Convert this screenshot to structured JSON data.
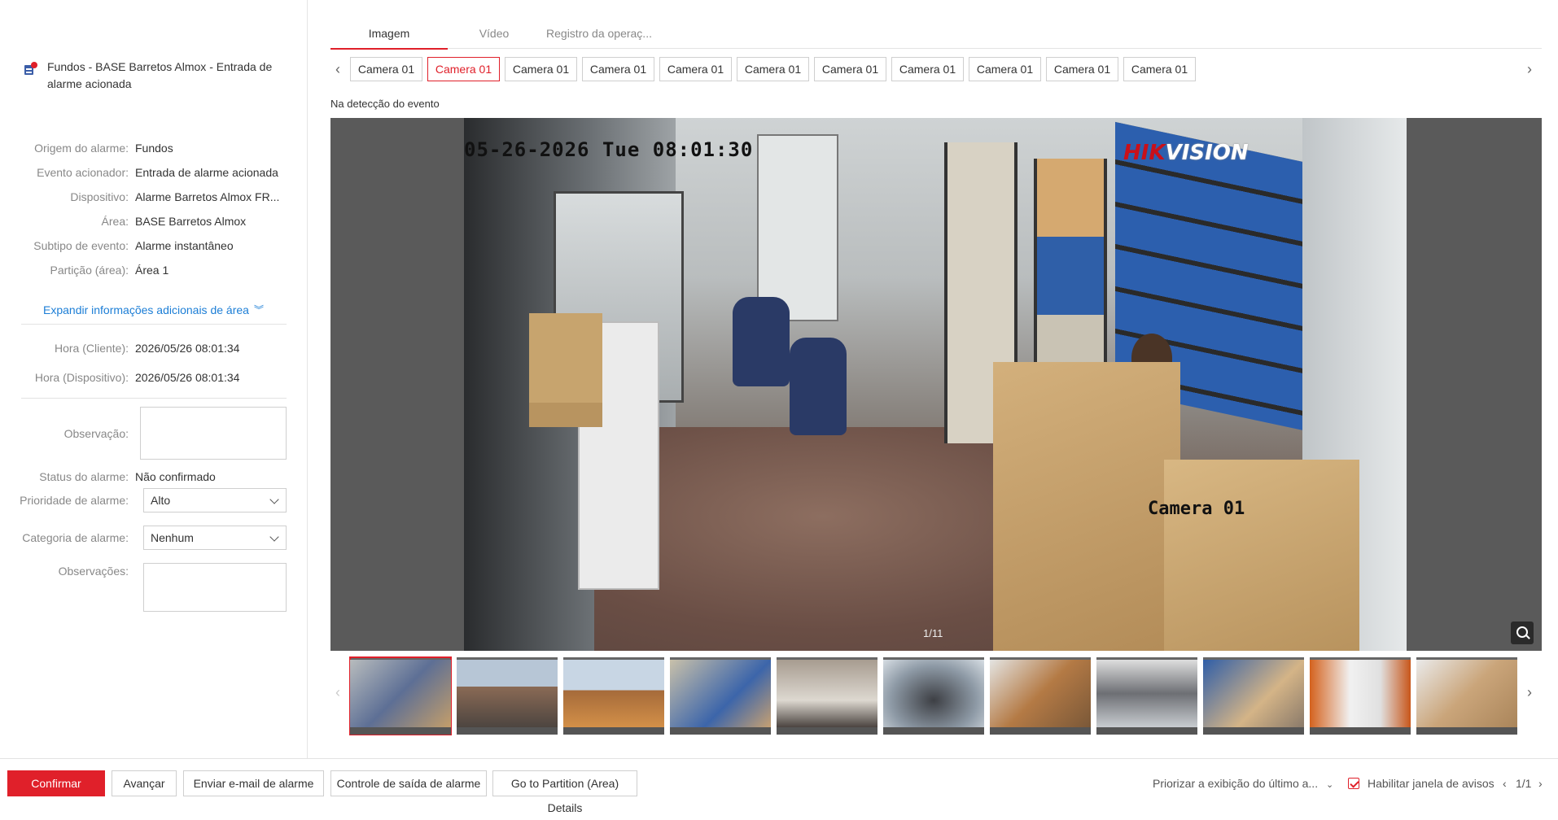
{
  "alarm": {
    "title": "Fundos - BASE Barretos Almox - Entrada de alarme acionada"
  },
  "details": [
    {
      "label": "Origem do alarme:",
      "value": "Fundos"
    },
    {
      "label": "Evento acionador:",
      "value": "Entrada de alarme acionada"
    },
    {
      "label": "Dispositivo:",
      "value": "Alarme Barretos Almox FR..."
    },
    {
      "label": "Área:",
      "value": "BASE Barretos Almox"
    },
    {
      "label": "Subtipo de evento:",
      "value": "Alarme instantâneo"
    },
    {
      "label": "Partição (área):",
      "value": "Área 1"
    }
  ],
  "expand_label": "Expandir informações adicionais de área",
  "times": [
    {
      "label": "Hora (Cliente):",
      "value": "2026/05/26 08:01:34"
    },
    {
      "label": "Hora (Dispositivo):",
      "value": "2026/05/26 08:01:34"
    }
  ],
  "form": {
    "observacao_label": "Observação:",
    "observacao_value": "",
    "status_label": "Status do alarme:",
    "status_value": "Não confirmado",
    "priority_label": "Prioridade de alarme:",
    "priority_value": "Alto",
    "category_label": "Categoria de alarme:",
    "category_value": "Nenhum",
    "observacoes_label": "Observações:",
    "observacoes_value": ""
  },
  "tabs": [
    "Imagem",
    "Vídeo",
    "Registro da operaç..."
  ],
  "active_tab": 0,
  "cameras": [
    "Camera 01",
    "Camera 01",
    "Camera 01",
    "Camera 01",
    "Camera 01",
    "Camera 01",
    "Camera 01",
    "Camera 01",
    "Camera 01",
    "Camera 01",
    "Camera 01"
  ],
  "active_camera": 1,
  "caption": "Na detecção do evento",
  "viewer": {
    "osd_timestamp": "05-26-2026 Tue 08:01:30",
    "osd_brand_red": "HIK",
    "osd_brand_white": "VISION",
    "osd_camera": "Camera 01",
    "page_indicator": "1/11"
  },
  "thumbnail_count": 11,
  "footer": {
    "confirm": "Confirmar",
    "next": "Avançar",
    "email": "Enviar e-mail de alarme",
    "output": "Controle de saída de alarme",
    "partition": "Go to Partition (Area) Details",
    "priority_view": "Priorizar a exibição do último a...",
    "enable_popup": "Habilitar janela de avisos",
    "pager": "1/1"
  },
  "colors": {
    "accent": "#e0202a",
    "link": "#1c7ed6"
  }
}
